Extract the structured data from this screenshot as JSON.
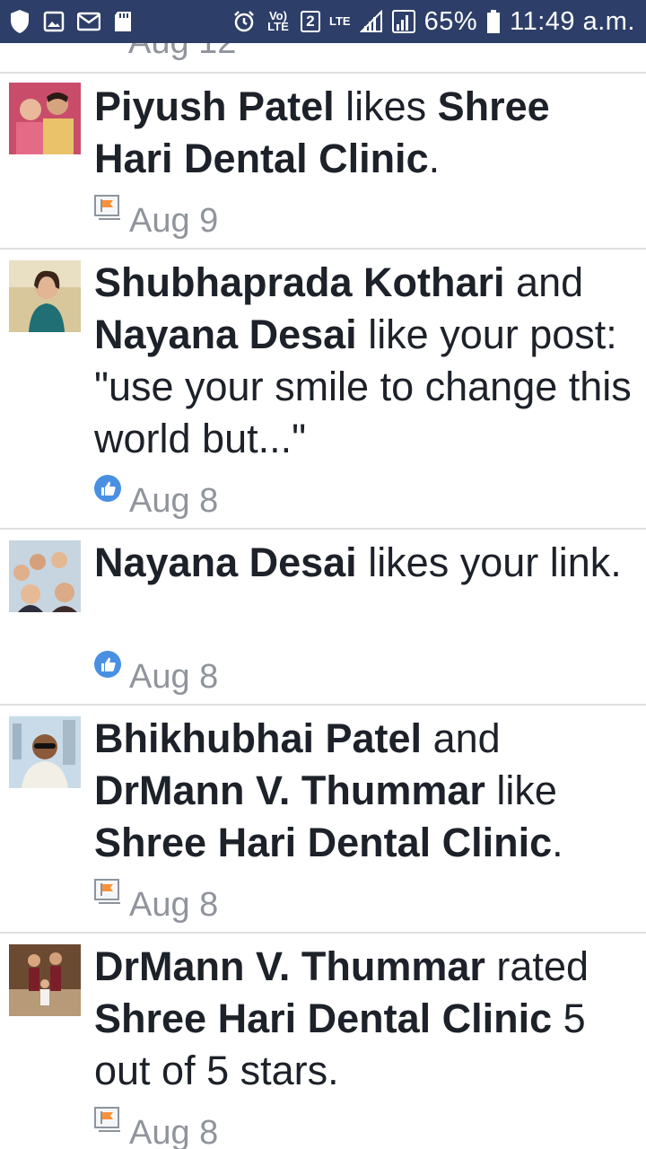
{
  "status_bar": {
    "network": "Vo) LTE",
    "sim": "2",
    "lte": "LTE",
    "battery": "65%",
    "time": "11:49 a.m."
  },
  "feed": {
    "partial_date": "Aug 12",
    "items": [
      {
        "parts": [
          {
            "text": "Piyush Patel",
            "bold": true
          },
          {
            "text": " likes ",
            "bold": false
          },
          {
            "text": "Shree Hari Dental Clinic",
            "bold": true
          },
          {
            "text": ".",
            "bold": false
          }
        ],
        "icon": "page-flag-icon",
        "date": "Aug 9"
      },
      {
        "parts": [
          {
            "text": "Shubhapradа Kothari",
            "bold": true
          },
          {
            "text": " and ",
            "bold": false
          },
          {
            "text": "Nayana Desai",
            "bold": true
          },
          {
            "text": " like your post: \"use your smile to change this world but...\"",
            "bold": false
          }
        ],
        "icon": "like-icon",
        "date": "Aug 8"
      },
      {
        "parts": [
          {
            "text": "Nayana Desai",
            "bold": true
          },
          {
            "text": " likes your link.",
            "bold": false
          }
        ],
        "icon": "like-icon",
        "date": "Aug 8"
      },
      {
        "parts": [
          {
            "text": "Bhikhubhai Patel",
            "bold": true
          },
          {
            "text": " and ",
            "bold": false
          },
          {
            "text": "DrMann V. Thummar",
            "bold": true
          },
          {
            "text": " like ",
            "bold": false
          },
          {
            "text": "Shree Hari Dental Clinic",
            "bold": true
          },
          {
            "text": ".",
            "bold": false
          }
        ],
        "icon": "page-flag-icon",
        "date": "Aug 8"
      },
      {
        "parts": [
          {
            "text": "DrMann V. Thummar",
            "bold": true
          },
          {
            "text": " rated ",
            "bold": false
          },
          {
            "text": "Shree Hari Dental Clinic",
            "bold": true
          },
          {
            "text": " 5 out of 5 stars.",
            "bold": false
          }
        ],
        "icon": "page-flag-icon",
        "date": "Aug 8"
      }
    ]
  }
}
